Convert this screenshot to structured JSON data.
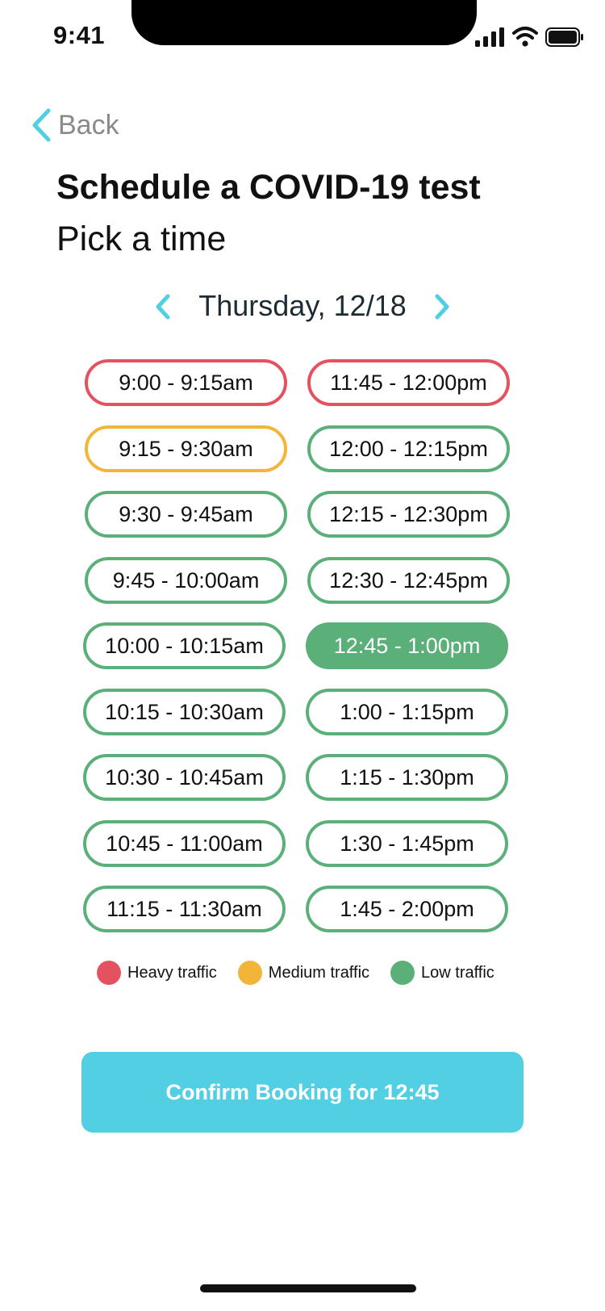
{
  "status_bar": {
    "time": "9:41"
  },
  "nav": {
    "back_label": "Back"
  },
  "header": {
    "title": "Schedule a COVID-19 test",
    "subtitle": "Pick a time"
  },
  "date_picker": {
    "label": "Thursday, 12/18"
  },
  "slots_left": [
    {
      "label": "9:00 - 9:15am",
      "traffic": "heavy",
      "selected": false
    },
    {
      "label": "9:15 - 9:30am",
      "traffic": "medium",
      "selected": false
    },
    {
      "label": "9:30 - 9:45am",
      "traffic": "low",
      "selected": false
    },
    {
      "label": "9:45 - 10:00am",
      "traffic": "low",
      "selected": false
    },
    {
      "label": "10:00 - 10:15am",
      "traffic": "low",
      "selected": false
    },
    {
      "label": "10:15 - 10:30am",
      "traffic": "low",
      "selected": false
    },
    {
      "label": "10:30 - 10:45am",
      "traffic": "low",
      "selected": false
    },
    {
      "label": "10:45 - 11:00am",
      "traffic": "low",
      "selected": false
    },
    {
      "label": "11:15 - 11:30am",
      "traffic": "low",
      "selected": false
    }
  ],
  "slots_right": [
    {
      "label": "11:45 - 12:00pm",
      "traffic": "heavy",
      "selected": false
    },
    {
      "label": "12:00 - 12:15pm",
      "traffic": "low",
      "selected": false
    },
    {
      "label": "12:15 - 12:30pm",
      "traffic": "low",
      "selected": false
    },
    {
      "label": "12:30 - 12:45pm",
      "traffic": "low",
      "selected": false
    },
    {
      "label": "12:45 - 1:00pm",
      "traffic": "low",
      "selected": true
    },
    {
      "label": "1:00 - 1:15pm",
      "traffic": "low",
      "selected": false
    },
    {
      "label": "1:15 - 1:30pm",
      "traffic": "low",
      "selected": false
    },
    {
      "label": "1:30 - 1:45pm",
      "traffic": "low",
      "selected": false
    },
    {
      "label": "1:45 - 2:00pm",
      "traffic": "low",
      "selected": false
    }
  ],
  "legend": [
    {
      "label": "Heavy traffic",
      "color": "#e4525f"
    },
    {
      "label": "Medium traffic",
      "color": "#f2b53a"
    },
    {
      "label": "Low traffic",
      "color": "#5bb07a"
    }
  ],
  "confirm": {
    "label": "Confirm Booking for 12:45"
  },
  "colors": {
    "accent": "#52cfe3",
    "heavy": "#e4525f",
    "medium": "#f2b53a",
    "low": "#5bb07a"
  }
}
